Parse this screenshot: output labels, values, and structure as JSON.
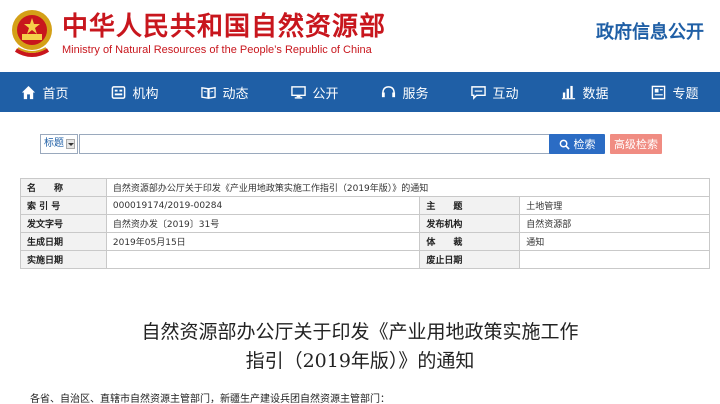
{
  "header": {
    "title_cn": "中华人民共和国自然资源部",
    "title_en": "Ministry of Natural Resources of the People’s Republic of China",
    "gov_info": "政府信息公开",
    "brand_color": "#c8161d",
    "accent_color": "#1f5fa6"
  },
  "nav": {
    "items": [
      {
        "label": "首页",
        "icon": "home-icon"
      },
      {
        "label": "机构",
        "icon": "org-icon"
      },
      {
        "label": "动态",
        "icon": "book-icon"
      },
      {
        "label": "公开",
        "icon": "monitor-icon"
      },
      {
        "label": "服务",
        "icon": "service-icon"
      },
      {
        "label": "互动",
        "icon": "chat-icon"
      },
      {
        "label": "数据",
        "icon": "chart-icon"
      },
      {
        "label": "专题",
        "icon": "topic-icon"
      }
    ]
  },
  "search": {
    "field_selected": "标题",
    "value": "",
    "search_label": "检索",
    "advanced_label": "高级检索"
  },
  "info": {
    "name_key": "名　　称",
    "name_val": "自然资源部办公厅关于印发《产业用地政策实施工作指引（2019年版）》的通知",
    "index_key": "索 引 号",
    "index_val": "000019174/2019-00284",
    "subject_key": "主　　题",
    "subject_val": "土地管理",
    "docno_key": "发文字号",
    "docno_val": "自然资办发〔2019〕31号",
    "issuer_key": "发布机构",
    "issuer_val": "自然资源部",
    "date_key": "生成日期",
    "date_val": "2019年05月15日",
    "genre_key": "体　　裁",
    "genre_val": "通知",
    "impl_key": "实施日期",
    "impl_val": "",
    "repeal_key": "废止日期",
    "repeal_val": ""
  },
  "article": {
    "title_line1": "自然资源部办公厅关于印发《产业用地政策实施工作",
    "title_line2": "指引（2019年版）》的通知",
    "body_start": "各省、自治区、直辖市自然资源主管部门，新疆生产建设兵团自然资源主管部门："
  }
}
